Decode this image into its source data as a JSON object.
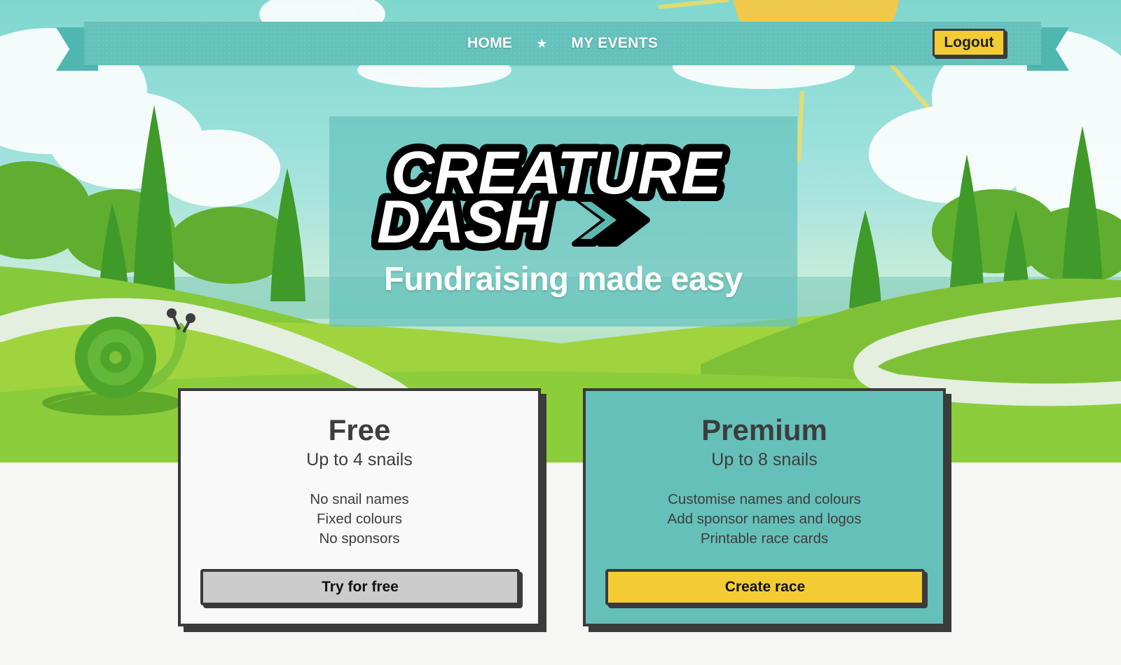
{
  "nav": {
    "home": "HOME",
    "separator": "★",
    "my_events": "MY EVENTS",
    "logout": "Logout"
  },
  "hero": {
    "logo_line1": "CREATURE",
    "logo_line2": "DASH",
    "tagline": "Fundraising made easy"
  },
  "plans": {
    "free": {
      "title": "Free",
      "subtitle": "Up to 4 snails",
      "features": [
        "No snail names",
        "Fixed colours",
        "No sponsors"
      ],
      "button": "Try for free"
    },
    "premium": {
      "title": "Premium",
      "subtitle": "Up to 8 snails",
      "features": [
        "Customise names and colours",
        "Add sponsor names and logos",
        "Printable race cards"
      ],
      "button": "Create race"
    }
  },
  "colors": {
    "teal": "#66c0ba",
    "yellow": "#f3cc33",
    "dark": "#3b3b3b"
  }
}
